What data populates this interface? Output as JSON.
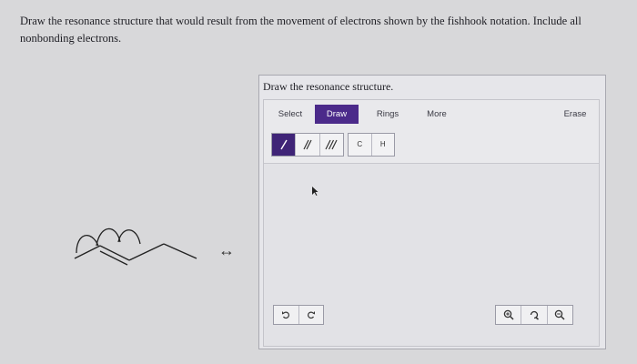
{
  "question": {
    "text": "Draw the resonance structure that would result from the movement of electrons shown by the fishhook notation. Include all nonbonding electrons."
  },
  "arrow_glyph": "↔",
  "panel": {
    "title": "Draw the resonance structure."
  },
  "toolbar": {
    "tabs": [
      "Select",
      "Draw",
      "Rings",
      "More",
      "Erase"
    ],
    "active_tab": "Draw",
    "bond_tools": [
      "single-bond",
      "double-bond",
      "triple-bond"
    ],
    "active_bond": "single-bond",
    "atoms": [
      "C",
      "H"
    ]
  },
  "bottom": {
    "undo": "undo",
    "redo": "redo",
    "zoom": [
      "zoom-in",
      "zoom-reset",
      "zoom-out"
    ]
  },
  "colors": {
    "accent": "#4b2a8a",
    "background": "#d8d8da"
  }
}
